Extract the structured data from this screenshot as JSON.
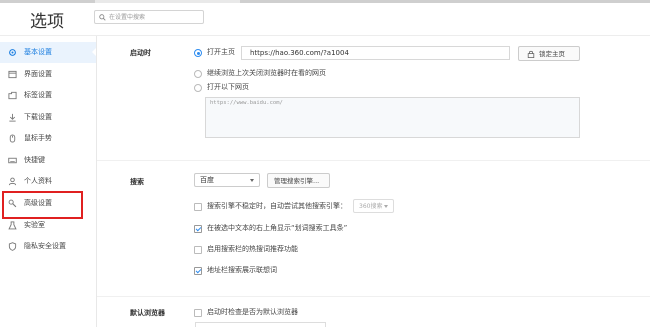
{
  "header": {
    "title": "选项",
    "search_placeholder": "在设置中搜索"
  },
  "sidebar": {
    "items": [
      {
        "label": "基本设置",
        "icon": "settings-icon",
        "active": true
      },
      {
        "label": "界面设置",
        "icon": "window-icon"
      },
      {
        "label": "标签设置",
        "icon": "tab-icon"
      },
      {
        "label": "下载设置",
        "icon": "download-icon"
      },
      {
        "label": "鼠标手势",
        "icon": "mouse-icon"
      },
      {
        "label": "快捷键",
        "icon": "keyboard-icon"
      },
      {
        "label": "个人资料",
        "icon": "user-icon"
      },
      {
        "label": "高级设置",
        "icon": "wrench-icon"
      },
      {
        "label": "实验室",
        "icon": "flask-icon"
      },
      {
        "label": "隐私安全设置",
        "icon": "shield-icon"
      }
    ],
    "active_color": "#1b7ee0",
    "highlight_color": "#e02020"
  },
  "startup": {
    "label": "启动时",
    "open_home_label": "打开主页",
    "home_url": "https://hao.360.com/?a1004",
    "lock_button_label": "锁定主页",
    "continue_label": "继续浏览上次关闭浏览器时在看的网页",
    "open_pages_label": "打开以下网页",
    "pages_placeholder": "https://www.baidu.com/"
  },
  "search": {
    "label": "搜索",
    "engine_selected": "百度",
    "manage_button_label": "管理搜索引擎...",
    "fallback_label": "搜索引擎不稳定时，自动尝试其他搜索引擎：",
    "fallback_engine": "360搜索",
    "fallback_checked": false,
    "toolbar_label": "在被选中文本的右上角显示“划词搜索工具条”",
    "toolbar_checked": true,
    "hot_words_label": "启用搜索栏的热搜词推荐功能",
    "hot_words_checked": false,
    "suggest_label": "地址栏搜索展示联想词",
    "suggest_checked": true
  },
  "default_browser": {
    "label": "默认浏览器",
    "check_label": "启动时检查是否为默认浏览器",
    "check_checked": false
  }
}
